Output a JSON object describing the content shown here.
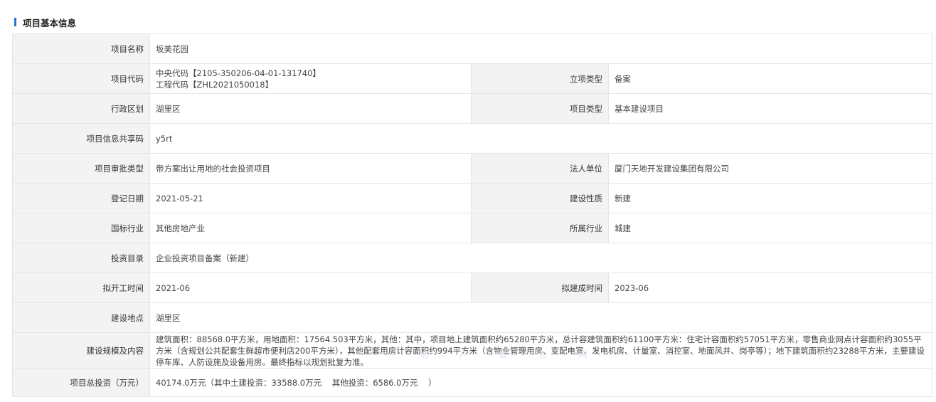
{
  "section": {
    "title": "项目基本信息",
    "accent_color": "#1e78d8"
  },
  "fields": {
    "project_name": {
      "label": "项目名称",
      "value": "坂美花园"
    },
    "project_code": {
      "label": "项目代码",
      "value_line1": "中央代码【2105-350206-04-01-131740】",
      "value_line2": "工程代码【ZHL2021050018】"
    },
    "approval_category": {
      "label": "立项类型",
      "value": "备案"
    },
    "district": {
      "label": "行政区划",
      "value": "湖里区"
    },
    "project_type": {
      "label": "项目类型",
      "value": "基本建设项目"
    },
    "share_code": {
      "label": "项目信息共享码",
      "value": "y5rt"
    },
    "review_type": {
      "label": "项目审批类型",
      "value": "带方案出让用地的社会投资项目"
    },
    "legal_entity": {
      "label": "法人单位",
      "value": "厦门天地开发建设集团有限公司"
    },
    "register_date": {
      "label": "登记日期",
      "value": "2021-05-21"
    },
    "construction_nature": {
      "label": "建设性质",
      "value": "新建"
    },
    "national_industry": {
      "label": "国标行业",
      "value": "其他房地产业"
    },
    "industry": {
      "label": "所属行业",
      "value": "城建"
    },
    "investment_catalog": {
      "label": "投资目录",
      "value": "企业投资项目备案（新建）"
    },
    "planned_start": {
      "label": "拟开工时间",
      "value": "2021-06"
    },
    "planned_finish": {
      "label": "拟建成时间",
      "value": "2023-06"
    },
    "location": {
      "label": "建设地点",
      "value": "湖里区"
    },
    "scale_content": {
      "label": "建设规模及内容",
      "value": "建筑面积：88568.0平方米，用地面积：17564.503平方米，其他：其中，项目地上建筑面积约65280平方米，总计容建筑面积约61100平方米：住宅计容面积约57051平方米，零售商业网点计容面积约3055平方米（含规划公共配套生鲜超市便利店200平方米），其他配套用房计容面积约994平方米（含物业管理用房、变配电室、发电机房、计量室、消控室、地面风井、岗亭等）；地下建筑面积约23288平方米，主要建设停车库、人防设施及设备用房。最终指标以规划批复为准。"
    },
    "total_investment": {
      "label": "项目总投资（万元）",
      "value": "40174.0万元（其中土建投资：33588.0万元    其他投资：6586.0万元    ）"
    }
  },
  "watermark": "地 产 数 告 网"
}
